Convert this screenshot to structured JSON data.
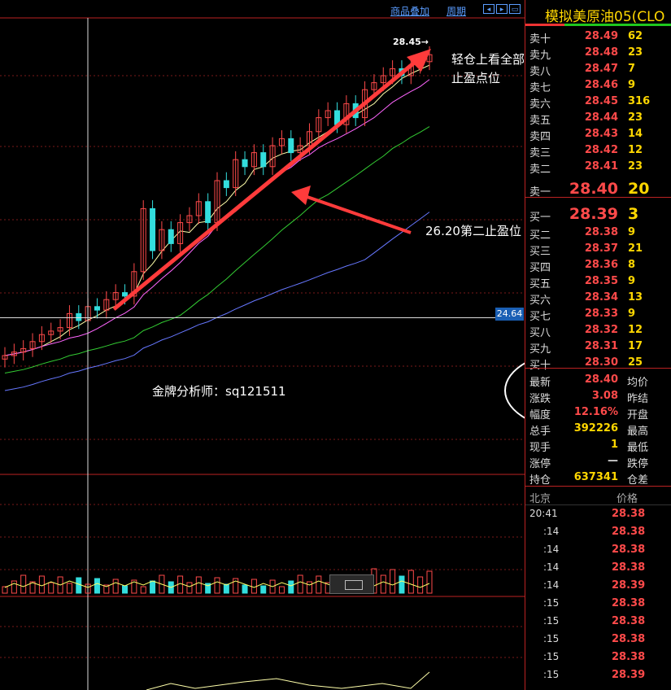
{
  "toolbar": {
    "overlay_label": "商品叠加",
    "period_label": "周期"
  },
  "annotations": {
    "note1_line1": "轻仓上看全部",
    "note1_line2": "止盈点位",
    "note2": "26.20第二止盈位",
    "analyst": "金牌分析师：sq121511"
  },
  "chart": {
    "peak_label": "28.45→",
    "cross_price": "24.64"
  },
  "panel": {
    "title": "模拟美原油05(CLO",
    "asks": [
      {
        "label": "卖十",
        "price": "28.49",
        "vol": "62"
      },
      {
        "label": "卖九",
        "price": "28.48",
        "vol": "23"
      },
      {
        "label": "卖八",
        "price": "28.47",
        "vol": "7"
      },
      {
        "label": "卖七",
        "price": "28.46",
        "vol": "9"
      },
      {
        "label": "卖六",
        "price": "28.45",
        "vol": "316"
      },
      {
        "label": "卖五",
        "price": "28.44",
        "vol": "23"
      },
      {
        "label": "卖四",
        "price": "28.43",
        "vol": "14"
      },
      {
        "label": "卖三",
        "price": "28.42",
        "vol": "12"
      },
      {
        "label": "卖二",
        "price": "28.41",
        "vol": "23"
      },
      {
        "label": "卖一",
        "price": "28.40",
        "vol": "20"
      }
    ],
    "bids": [
      {
        "label": "买一",
        "price": "28.39",
        "vol": "3"
      },
      {
        "label": "买二",
        "price": "28.38",
        "vol": "9"
      },
      {
        "label": "买三",
        "price": "28.37",
        "vol": "21"
      },
      {
        "label": "买四",
        "price": "28.36",
        "vol": "8"
      },
      {
        "label": "买五",
        "price": "28.35",
        "vol": "9"
      },
      {
        "label": "买六",
        "price": "28.34",
        "vol": "13"
      },
      {
        "label": "买七",
        "price": "28.33",
        "vol": "9"
      },
      {
        "label": "买八",
        "price": "28.32",
        "vol": "12"
      },
      {
        "label": "买九",
        "price": "28.31",
        "vol": "17"
      },
      {
        "label": "买十",
        "price": "28.30",
        "vol": "25"
      }
    ],
    "info": [
      {
        "label": "最新",
        "value": "28.40",
        "label2": "均价",
        "color": "#ff4a4a"
      },
      {
        "label": "涨跌",
        "value": "3.08",
        "label2": "昨结",
        "color": "#ff4a4a"
      },
      {
        "label": "幅度",
        "value": "12.16%",
        "label2": "开盘",
        "color": "#ff4a4a"
      },
      {
        "label": "总手",
        "value": "392226",
        "label2": "最高",
        "color": "#ffd700"
      },
      {
        "label": "现手",
        "value": "1",
        "label2": "最低",
        "color": "#ffd700"
      },
      {
        "label": "涨停",
        "value": "—",
        "label2": "跌停",
        "color": "#ddd"
      },
      {
        "label": "持仓",
        "value": "637341",
        "label2": "仓差",
        "color": "#ffd700"
      }
    ],
    "ticks_header": {
      "city": "北京",
      "price": "价格"
    },
    "ticks": [
      {
        "time": "20:41",
        "price": "28.38"
      },
      {
        "time": ":14",
        "price": "28.38"
      },
      {
        "time": ":14",
        "price": "28.38"
      },
      {
        "time": ":14",
        "price": "28.38"
      },
      {
        "time": ":14",
        "price": "28.39"
      },
      {
        "time": ":15",
        "price": "28.38"
      },
      {
        "time": ":15",
        "price": "28.38"
      },
      {
        "time": ":15",
        "price": "28.38"
      },
      {
        "time": ":15",
        "price": "28.38"
      },
      {
        "time": ":15",
        "price": "28.39"
      }
    ]
  },
  "chart_data": {
    "type": "candlestick",
    "title": "",
    "series_note": "",
    "closes": [
      24.1,
      24.15,
      24.2,
      24.3,
      24.4,
      24.45,
      24.5,
      24.7,
      24.6,
      24.8,
      24.75,
      24.9,
      25.0,
      24.95,
      25.3,
      26.2,
      25.6,
      25.9,
      25.7,
      26.0,
      26.1,
      26.3,
      26.0,
      26.6,
      26.5,
      26.9,
      26.8,
      27.0,
      26.8,
      27.1,
      27.2,
      27.0,
      27.1,
      27.3,
      27.5,
      27.6,
      27.4,
      27.7,
      27.5,
      27.9,
      28.0,
      28.1,
      28.2,
      28.1,
      28.25,
      28.3,
      28.4
    ],
    "y_axis_marker": 24.64,
    "peak": 28.45
  }
}
